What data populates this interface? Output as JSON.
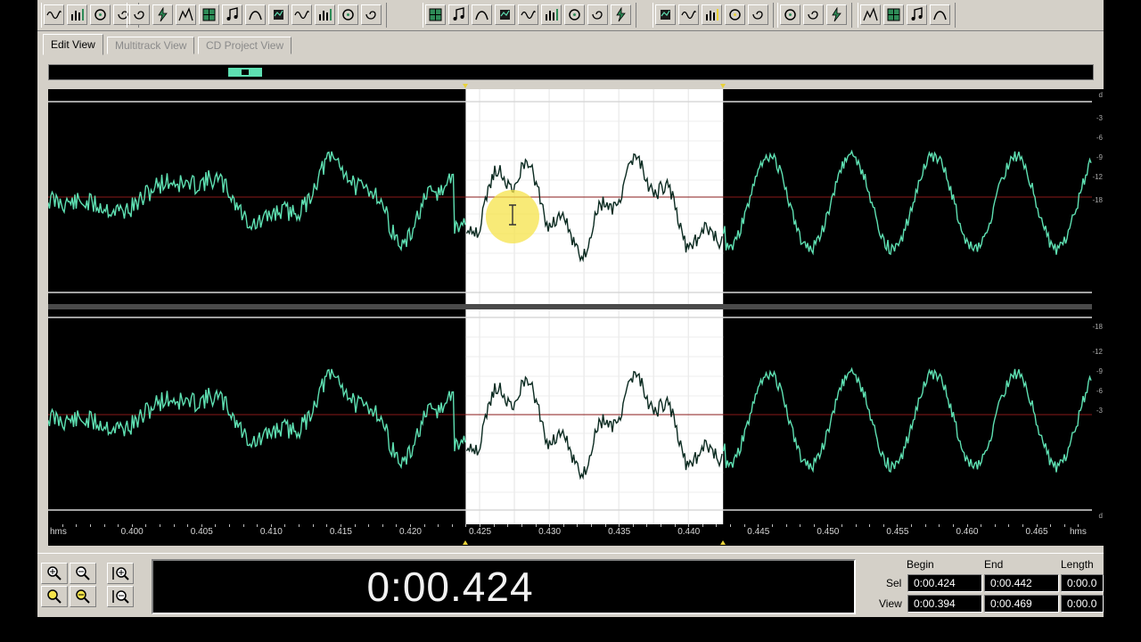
{
  "tabs": [
    {
      "label": "Edit View",
      "active": true
    },
    {
      "label": "Multitrack View",
      "active": false
    },
    {
      "label": "CD Project View",
      "active": false
    }
  ],
  "toolbar": {
    "groups": [
      [
        "spectral-icon",
        "waveform-icon",
        "crossfade-icon",
        "mixer-icon"
      ],
      [
        "amplify-icon",
        "timer-icon",
        "noise-gate-icon",
        "phase-icon",
        "envelope-icon",
        "delay-icon",
        "echo-icon",
        "filter-icon",
        "reverb-icon",
        "flanger-icon",
        "pitch-icon"
      ],
      [
        "marker-icon",
        "meter-icon",
        "stats-icon",
        "frequency-icon",
        "eq-icon",
        "loop-icon",
        "cue-icon",
        "bars-icon",
        "grid-icon"
      ],
      [
        "graph1-icon",
        "graph2-icon",
        "graph3-icon",
        "graph4-icon",
        "graph5-icon"
      ],
      [
        "curve-icon",
        "note-icon",
        "music-icon"
      ],
      [
        "bell-icon",
        "horn-icon",
        "tuning-fork-icon",
        "snap-icon"
      ]
    ]
  },
  "ruler": {
    "labels": [
      "hms",
      "0.400",
      "0.405",
      "0.410",
      "0.415",
      "0.420",
      "0.425",
      "0.430",
      "0.435",
      "0.440",
      "0.445",
      "0.450",
      "0.455",
      "0.460",
      "0.465",
      "hms"
    ],
    "view_start": 0.394,
    "view_end": 0.469
  },
  "vertical_scale": [
    "d",
    "-3",
    "-6",
    "-9",
    "-12",
    "-18",
    "-18",
    "-12",
    "-9",
    "-6",
    "-3",
    "d"
  ],
  "selection": {
    "begin_time": 0.424,
    "end_time": 0.4425
  },
  "time_display": "0:00.424",
  "selection_panel": {
    "headers": [
      "Begin",
      "End",
      "Length"
    ],
    "rows": [
      {
        "label": "Sel",
        "begin": "0:00.424",
        "end": "0:00.442",
        "length": "0:00.0"
      },
      {
        "label": "View",
        "begin": "0:00.394",
        "end": "0:00.469",
        "length": "0:00.0"
      }
    ]
  },
  "colors": {
    "waveform": "#5ee0b2",
    "waveform_selected": "#0a2a20",
    "selection_bg": "#ffffff",
    "background": "#000000",
    "centerline": "#8a1a1a",
    "cursor_highlight": "#f5e34a"
  }
}
